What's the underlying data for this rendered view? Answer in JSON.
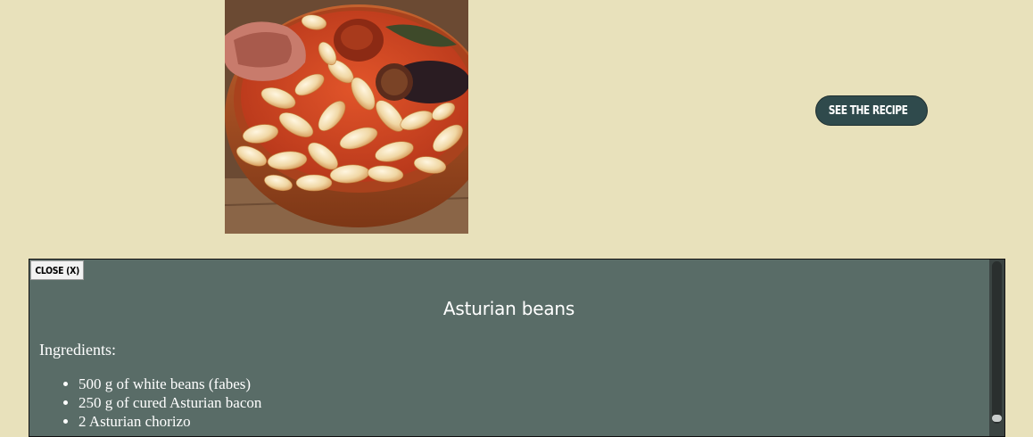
{
  "page": {
    "background": "#e8e1bb"
  },
  "photo": {
    "alt": "Asturian beans dish"
  },
  "see_recipe": {
    "label": "SEE THE RECIPE",
    "icon": "chevron-up-icon"
  },
  "panel": {
    "close_label": "CLOSE (X)",
    "title": "Asturian beans",
    "ingredients_heading": "Ingredients:",
    "ingredients": [
      "500 g of white beans (fabes)",
      "250 g of cured Asturian bacon",
      "2 Asturian chorizo"
    ]
  },
  "colors": {
    "button_bg": "#2f4a4c",
    "panel_bg": "#596c67"
  }
}
